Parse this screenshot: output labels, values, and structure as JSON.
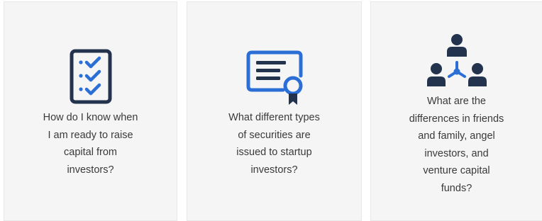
{
  "cards": [
    {
      "icon": "checklist-icon",
      "text": "How do I know when\nI am ready to raise\ncapital from\ninvestors?"
    },
    {
      "icon": "certificate-icon",
      "text": "What different types\nof securities are\nissued to startup\ninvestors?"
    },
    {
      "icon": "investor-network-icon",
      "text": "What are the\ndifferences in friends\nand family, angel\ninvestors, and\nventure capital\nfunds?"
    }
  ],
  "colors": {
    "icon_dark": "#23334d",
    "icon_blue": "#2b6fd6",
    "card_background": "#f5f5f5",
    "text": "#3a3a3a"
  }
}
